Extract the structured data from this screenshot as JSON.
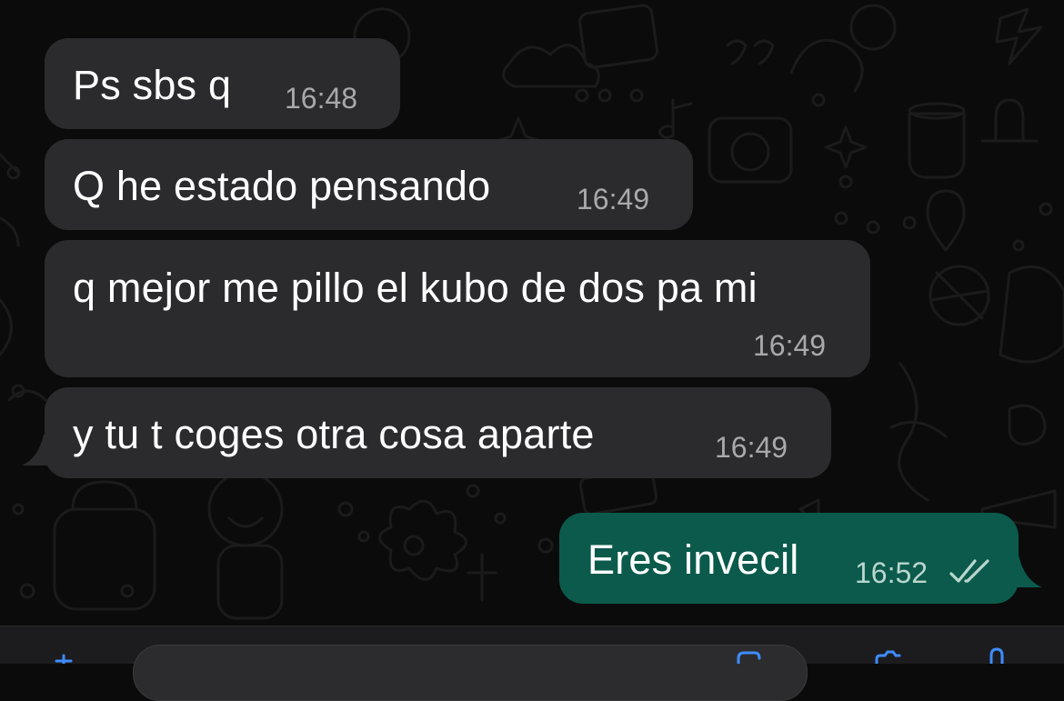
{
  "messages": [
    {
      "direction": "incoming",
      "text": "Ps sbs q",
      "time": "16:48"
    },
    {
      "direction": "incoming",
      "text": "Q he estado pensando",
      "time": "16:49"
    },
    {
      "direction": "incoming",
      "text": "q mejor me pillo el kubo de dos pa mi",
      "time": "16:49"
    },
    {
      "direction": "incoming",
      "text": "y tu t coges otra cosa aparte",
      "time": "16:49"
    },
    {
      "direction": "outgoing",
      "text": "Eres invecil",
      "time": "16:52",
      "status_icon": "double-check-icon"
    }
  ],
  "composer": {
    "icons": [
      "plus-icon",
      "sticker-icon",
      "camera-icon",
      "mic-icon"
    ]
  },
  "colors": {
    "background": "#0b0b0b",
    "incoming_bubble": "#2b2b2d",
    "outgoing_bubble": "#0b5a4c",
    "timestamp": "#a9a9ad"
  }
}
